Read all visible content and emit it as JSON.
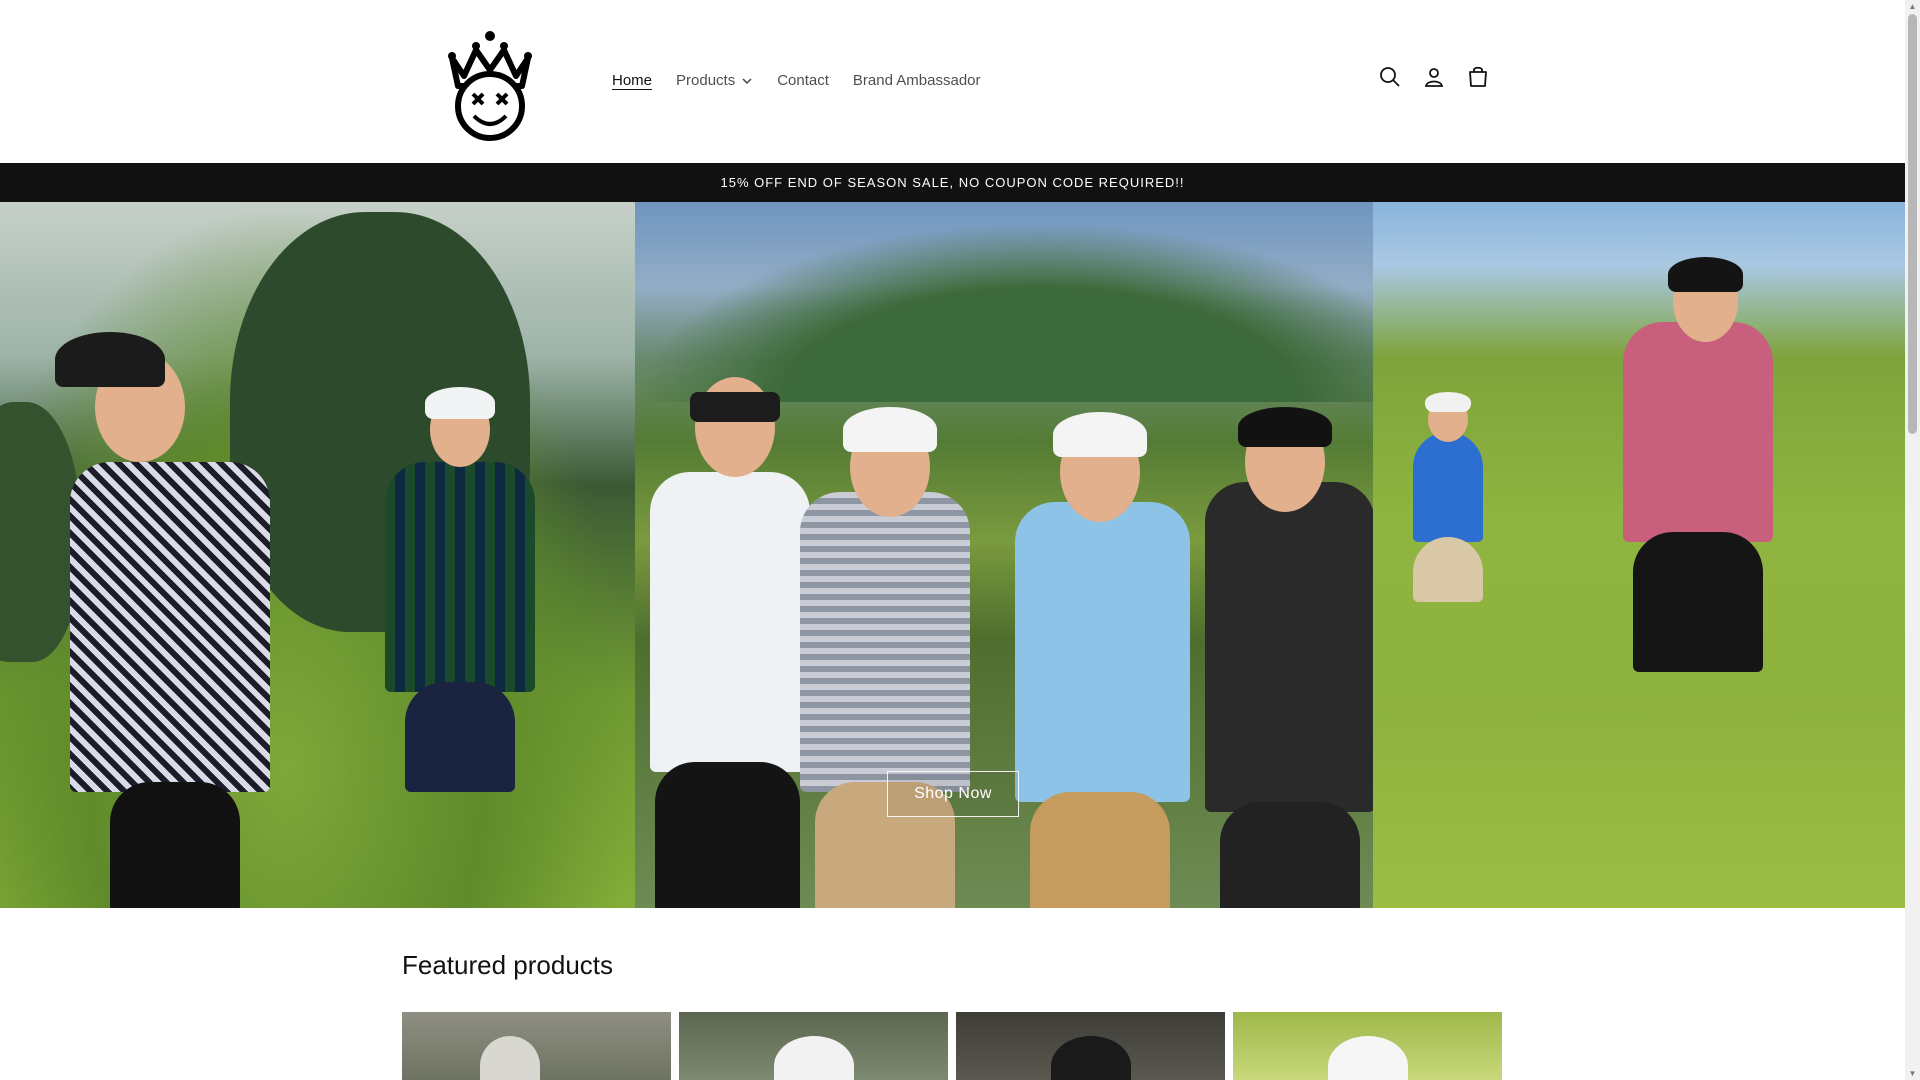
{
  "header": {
    "logo_alt": "Crown smiley logo",
    "nav": [
      {
        "label": "Home",
        "active": true
      },
      {
        "label": "Products",
        "has_dropdown": true
      },
      {
        "label": "Contact"
      },
      {
        "label": "Brand Ambassador"
      }
    ],
    "icons": [
      "search-icon",
      "account-icon",
      "cart-icon"
    ]
  },
  "announcement": {
    "text": "15% OFF END OF SEASON SALE, NO COUPON CODE REQUIRED!!"
  },
  "hero": {
    "button_label": "Shop Now"
  },
  "featured": {
    "title": "Featured products"
  },
  "colors": {
    "announcement_bg": "#111111",
    "text": "#121212"
  }
}
